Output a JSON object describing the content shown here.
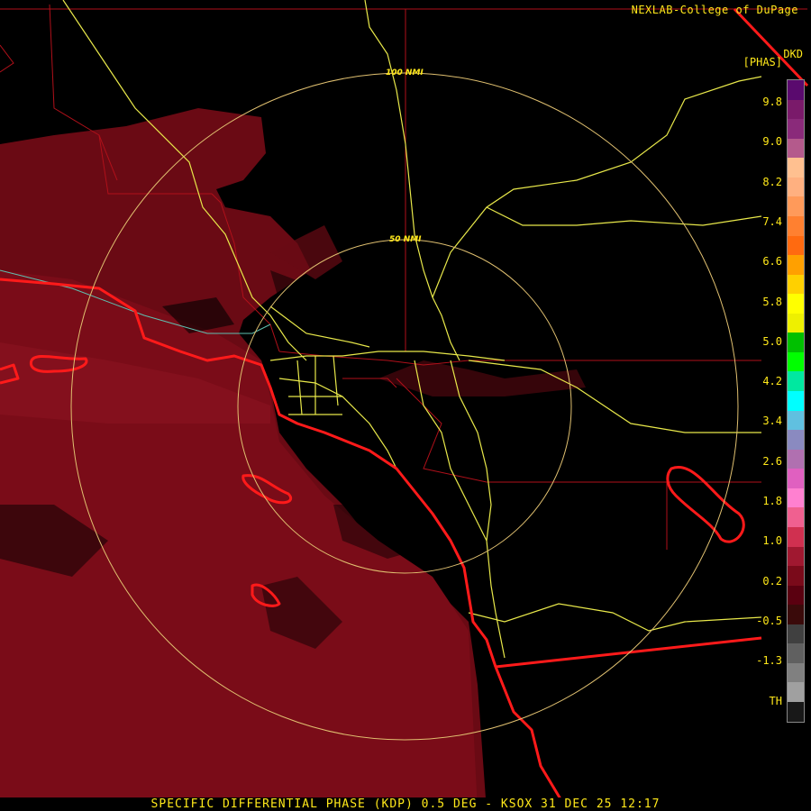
{
  "credit": "NEXLAB-College of DuPage",
  "product_code": "DKD",
  "units": "[PHAS]",
  "caption": "SPECIFIC DIFFERENTIAL PHASE (KDP) 0.5 DEG - KSOX 31 DEC 25 12:17",
  "ring_labels": [
    "50 NMI",
    "100 NMI"
  ],
  "colorbar": {
    "ticks": [
      "9.8",
      "9.0",
      "8.2",
      "7.4",
      "6.6",
      "5.8",
      "5.0",
      "4.2",
      "3.4",
      "2.6",
      "1.8",
      "1.0",
      "0.2",
      "-0.5",
      "-1.3",
      "TH"
    ],
    "colors": [
      "#5a0a6e",
      "#7a1a6a",
      "#8a2a7a",
      "#b45a8c",
      "#ffc090",
      "#ffb080",
      "#ff9a5a",
      "#ff8030",
      "#ff6a10",
      "#ffa000",
      "#ffd000",
      "#ffff00",
      "#eef000",
      "#00c000",
      "#00ff00",
      "#00e8a0",
      "#00ffff",
      "#60c0e0",
      "#8a8ac0",
      "#b070b0",
      "#e060c0",
      "#ff80d0",
      "#f06090",
      "#d03050",
      "#a01830",
      "#7a0a1a",
      "#5a0010",
      "#3a0a0a",
      "#404040",
      "#606060",
      "#808080",
      "#a0a0a0",
      "#181818"
    ]
  }
}
